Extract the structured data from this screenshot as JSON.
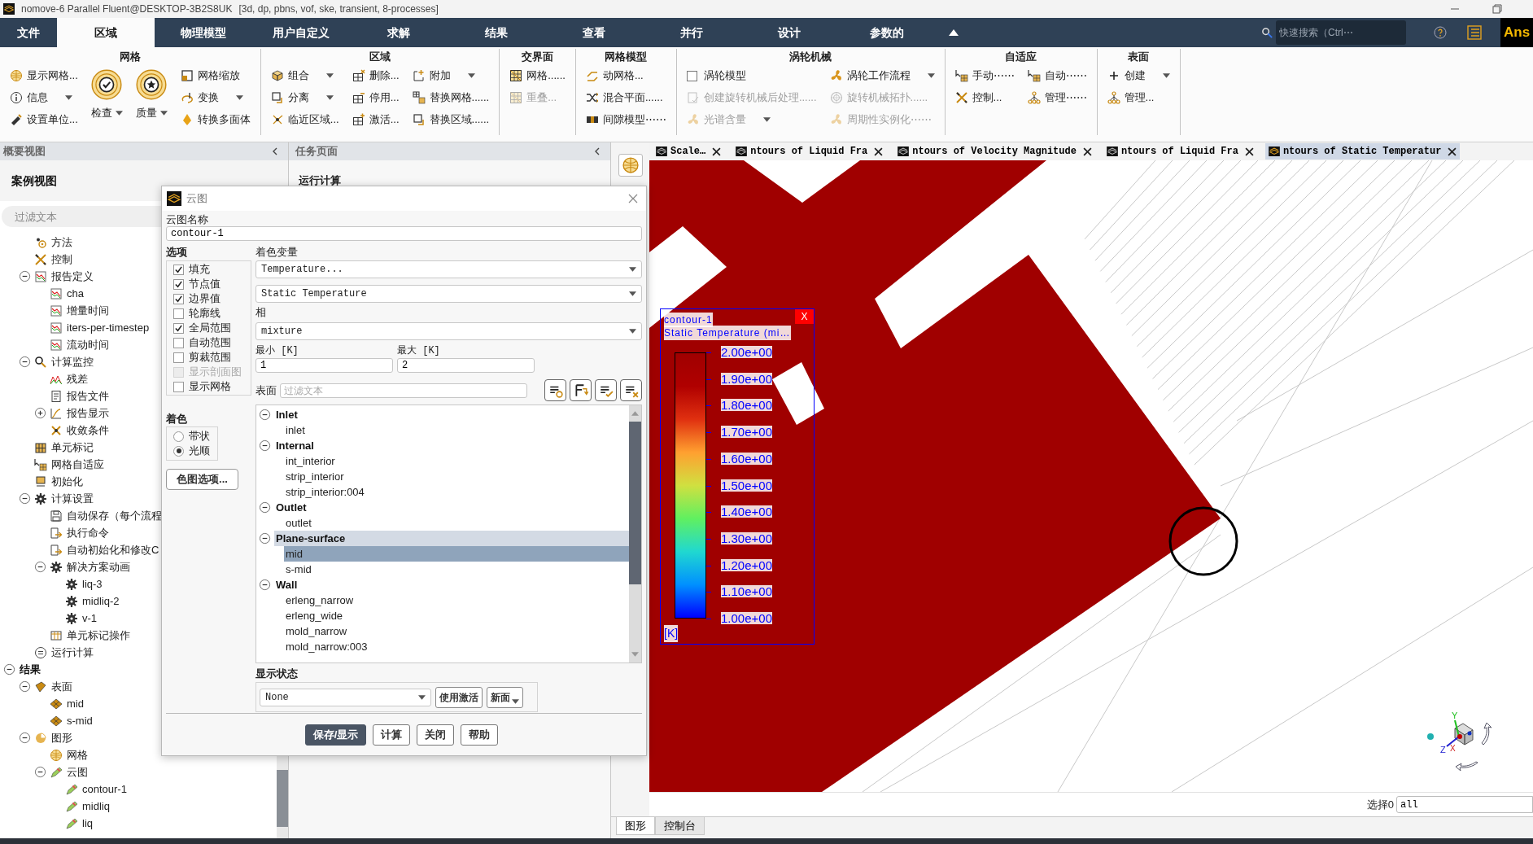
{
  "window": {
    "title": "nomove-6 Parallel Fluent@DESKTOP-3B2S8UK",
    "subtitle": "[3d, dp, pbns, vof, ske, transient, 8-processes]"
  },
  "menu_tabs": [
    {
      "label": "文件",
      "selected": false
    },
    {
      "label": "区域",
      "selected": true
    },
    {
      "label": "物理模型",
      "selected": false
    },
    {
      "label": "用户自定义",
      "selected": false
    },
    {
      "label": "求解",
      "selected": false
    },
    {
      "label": "结果",
      "selected": false
    },
    {
      "label": "查看",
      "selected": false
    },
    {
      "label": "并行",
      "selected": false
    },
    {
      "label": "设计",
      "selected": false
    },
    {
      "label": "参数的",
      "selected": false
    }
  ],
  "search": {
    "placeholder": "快速搜索（Ctrl⋯"
  },
  "logo": "Ans",
  "ribbon": [
    {
      "title": "网格",
      "columns": [
        [
          {
            "kind": "small",
            "label": "显示网格...",
            "disabled": false,
            "dropdown": false
          },
          {
            "kind": "small",
            "label": "信息",
            "disabled": false,
            "dropdown": true
          },
          {
            "kind": "small",
            "label": "设置单位...",
            "disabled": false,
            "dropdown": false
          }
        ],
        [
          {
            "kind": "large",
            "label": "检查",
            "disabled": false,
            "dropdown": true
          }
        ],
        [
          {
            "kind": "large",
            "label": "质量",
            "disabled": false,
            "dropdown": true
          }
        ],
        [
          {
            "kind": "small",
            "label": "网格缩放",
            "disabled": false,
            "dropdown": false
          },
          {
            "kind": "small",
            "label": "变换",
            "disabled": false,
            "dropdown": true
          },
          {
            "kind": "small",
            "label": "转换多面体",
            "disabled": false,
            "dropdown": false
          }
        ]
      ]
    },
    {
      "title": "区域",
      "columns": [
        [
          {
            "kind": "small",
            "label": "组合",
            "disabled": false,
            "dropdown": true
          },
          {
            "kind": "small",
            "label": "分离",
            "disabled": false,
            "dropdown": true
          },
          {
            "kind": "small",
            "label": "临近区域...",
            "disabled": false,
            "dropdown": false
          }
        ],
        [
          {
            "kind": "small",
            "label": "删除...",
            "disabled": false,
            "dropdown": false
          },
          {
            "kind": "small",
            "label": "停用...",
            "disabled": false,
            "dropdown": false
          },
          {
            "kind": "small",
            "label": "激活...",
            "disabled": false,
            "dropdown": false
          }
        ],
        [
          {
            "kind": "small",
            "label": "附加",
            "disabled": false,
            "dropdown": true
          },
          {
            "kind": "small",
            "label": "替换网格......",
            "disabled": false,
            "dropdown": false
          },
          {
            "kind": "small",
            "label": "替换区域......",
            "disabled": false,
            "dropdown": false
          }
        ]
      ]
    },
    {
      "title": "交界面",
      "columns": [
        [
          {
            "kind": "small",
            "label": "网格......",
            "disabled": false,
            "dropdown": false
          },
          {
            "kind": "small",
            "label": "重叠...",
            "disabled": true,
            "dropdown": false
          }
        ]
      ]
    },
    {
      "title": "网格模型",
      "columns": [
        [
          {
            "kind": "small",
            "label": "动网格...",
            "disabled": false,
            "dropdown": false
          },
          {
            "kind": "small",
            "label": "混合平面......",
            "disabled": false,
            "dropdown": false
          },
          {
            "kind": "small",
            "label": "间隙模型⋯⋯",
            "disabled": false,
            "dropdown": false
          }
        ]
      ]
    },
    {
      "title": "涡轮机械",
      "columns": [
        [
          {
            "kind": "checkbox",
            "label": "涡轮模型",
            "checked": false,
            "disabled": false
          },
          {
            "kind": "small",
            "label": "创建旋转机械后处理......",
            "disabled": true,
            "dropdown": false
          },
          {
            "kind": "small",
            "label": "光谱含量",
            "disabled": true,
            "dropdown": true
          }
        ],
        [
          {
            "kind": "small",
            "label": "涡轮工作流程",
            "disabled": false,
            "dropdown": true
          },
          {
            "kind": "small",
            "label": "旋转机械拓扑......",
            "disabled": true,
            "dropdown": false
          },
          {
            "kind": "small",
            "label": "周期性实例化⋯⋯",
            "disabled": true,
            "dropdown": false
          }
        ]
      ]
    },
    {
      "title": "自适应",
      "columns": [
        [
          {
            "kind": "small",
            "label": "手动⋯⋯",
            "disabled": false,
            "dropdown": false
          },
          {
            "kind": "small",
            "label": "控制...",
            "disabled": false,
            "dropdown": false
          }
        ],
        [
          {
            "kind": "small",
            "label": "自动⋯⋯",
            "disabled": false,
            "dropdown": false
          },
          {
            "kind": "small",
            "label": "管理⋯⋯",
            "disabled": false,
            "dropdown": false
          }
        ]
      ]
    },
    {
      "title": "表面",
      "columns": [
        [
          {
            "kind": "small",
            "label": "创建",
            "disabled": false,
            "dropdown": true
          },
          {
            "kind": "small",
            "label": "管理...",
            "disabled": false,
            "dropdown": false
          }
        ]
      ]
    }
  ],
  "outline": {
    "title": "概要视图",
    "section": "案例视图",
    "filter_placeholder": "过滤文本",
    "tree": [
      {
        "children": [
          {
            "label": "方法"
          },
          {
            "label": "控制"
          },
          {
            "label": "报告定义",
            "expanded": true,
            "children": [
              {
                "label": "cha"
              },
              {
                "label": "增量时间"
              },
              {
                "label": "iters-per-timestep"
              },
              {
                "label": "流动时间"
              }
            ]
          },
          {
            "label": "计算监控",
            "expanded": true,
            "children": [
              {
                "label": "残差"
              },
              {
                "label": "报告文件"
              },
              {
                "label": "报告显示",
                "expanded": false
              },
              {
                "label": "收敛条件"
              }
            ]
          },
          {
            "label": "单元标记"
          },
          {
            "label": "网格自适应"
          },
          {
            "label": "初始化"
          },
          {
            "label": "计算设置",
            "expanded": true,
            "children": [
              {
                "label": "自动保存（每个流程"
              },
              {
                "label": "执行命令"
              },
              {
                "label": "自动初始化和修改C"
              },
              {
                "label": "解决方案动画",
                "expanded": true,
                "children": [
                  {
                    "label": "liq-3"
                  },
                  {
                    "label": "midliq-2"
                  },
                  {
                    "label": "v-1"
                  }
                ]
              },
              {
                "label": "单元标记操作"
              }
            ]
          },
          {
            "label": "运行计算"
          }
        ]
      },
      {
        "label": "结果",
        "expanded": true,
        "children": [
          {
            "label": "表面",
            "expanded": true,
            "children": [
              {
                "label": "mid"
              },
              {
                "label": "s-mid"
              }
            ]
          },
          {
            "label": "图形",
            "expanded": true,
            "children": [
              {
                "label": "网格"
              },
              {
                "label": "云图",
                "expanded": true,
                "children": [
                  {
                    "label": "contour-1"
                  },
                  {
                    "label": "midliq"
                  },
                  {
                    "label": "liq"
                  }
                ]
              }
            ]
          }
        ]
      }
    ]
  },
  "task_page": {
    "title": "任务页面",
    "heading": "运行计算"
  },
  "dialog": {
    "title": "云图",
    "name_label": "云图名称",
    "name": "contour-1",
    "options_label": "选项",
    "options": [
      {
        "label": "填充",
        "checked": true,
        "disabled": false
      },
      {
        "label": "节点值",
        "checked": true,
        "disabled": false
      },
      {
        "label": "边界值",
        "checked": true,
        "disabled": false
      },
      {
        "label": "轮廓线",
        "checked": false,
        "disabled": false
      },
      {
        "label": "全局范围",
        "checked": true,
        "disabled": false
      },
      {
        "label": "自动范围",
        "checked": false,
        "disabled": false
      },
      {
        "label": "剪裁范围",
        "checked": false,
        "disabled": false
      },
      {
        "label": "显示剖面图",
        "checked": false,
        "disabled": true
      },
      {
        "label": "显示网格",
        "checked": false,
        "disabled": false
      }
    ],
    "coloring_label": "着色",
    "coloring": [
      {
        "label": "带状",
        "selected": false
      },
      {
        "label": "光顺",
        "selected": true
      }
    ],
    "colormap_button": "色图选项...",
    "variable_label": "着色变量",
    "variable": "Temperature...",
    "subvariable": "Static Temperature",
    "phase_label": "相",
    "phase": "mixture",
    "min_label": "最小 [K]",
    "min": "1",
    "max_label": "最大 [K]",
    "max": "2",
    "surfaces_label": "表面",
    "surfaces_filter_placeholder": "过滤文本",
    "surface_groups": [
      {
        "label": "Inlet",
        "expanded": true,
        "highlighted": false,
        "children": [
          {
            "label": "inlet",
            "selected": false
          }
        ]
      },
      {
        "label": "Internal",
        "expanded": true,
        "highlighted": false,
        "children": [
          {
            "label": "int_interior",
            "selected": false
          },
          {
            "label": "strip_interior",
            "selected": false
          },
          {
            "label": "strip_interior:004",
            "selected": false
          }
        ]
      },
      {
        "label": "Outlet",
        "expanded": true,
        "highlighted": false,
        "children": [
          {
            "label": "outlet",
            "selected": false
          }
        ]
      },
      {
        "label": "Plane-surface",
        "expanded": true,
        "highlighted": true,
        "children": [
          {
            "label": "mid",
            "selected": true
          },
          {
            "label": "s-mid",
            "selected": false
          }
        ]
      },
      {
        "label": "Wall",
        "expanded": true,
        "highlighted": false,
        "children": [
          {
            "label": "erleng_narrow",
            "selected": false
          },
          {
            "label": "erleng_wide",
            "selected": false
          },
          {
            "label": "mold_narrow",
            "selected": false
          },
          {
            "label": "mold_narrow:003",
            "selected": false
          }
        ]
      }
    ],
    "display_state_label": "显示状态",
    "display_state": "None",
    "use_active_button": "使用激活",
    "new_button": "新面",
    "buttons": [
      {
        "label": "保存/显示",
        "primary": true
      },
      {
        "label": "计算",
        "primary": false
      },
      {
        "label": "关闭",
        "primary": false
      },
      {
        "label": "帮助",
        "primary": false
      }
    ]
  },
  "graphics": {
    "tabs": [
      {
        "label": "Scale…",
        "selected": false
      },
      {
        "label": "ntours of Liquid Fra",
        "selected": false
      },
      {
        "label": "ntours of Velocity Magnitude",
        "selected": false
      },
      {
        "label": "ntours of Liquid Fra",
        "selected": false
      },
      {
        "label": "ntours of Static Temperatur",
        "selected": true
      }
    ],
    "legend": {
      "title": "contour-1",
      "subtitle": "Static Temperature (mi…",
      "close": "X",
      "labels": [
        "2.00e+00",
        "1.90e+00",
        "1.80e+00",
        "1.70e+00",
        "1.60e+00",
        "1.50e+00",
        "1.40e+00",
        "1.30e+00",
        "1.20e+00",
        "1.10e+00",
        "1.00e+00"
      ],
      "unit": "[K]"
    },
    "axis_labels": [
      "Y",
      "Z",
      "X"
    ],
    "selection": {
      "label": "选择0",
      "value": "all"
    }
  },
  "bottom_tabs": [
    {
      "label": "图形",
      "selected": true
    },
    {
      "label": "控制台",
      "selected": false
    }
  ]
}
